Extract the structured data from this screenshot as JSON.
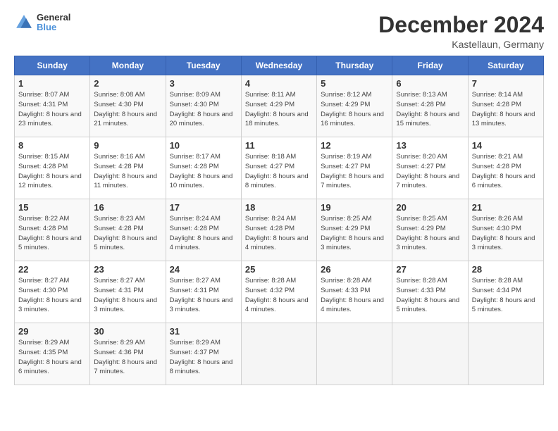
{
  "header": {
    "logo": {
      "line1": "General",
      "line2": "Blue"
    },
    "title": "December 2024",
    "subtitle": "Kastellaun, Germany"
  },
  "weekdays": [
    "Sunday",
    "Monday",
    "Tuesday",
    "Wednesday",
    "Thursday",
    "Friday",
    "Saturday"
  ],
  "weeks": [
    [
      {
        "day": "1",
        "sunrise": "Sunrise: 8:07 AM",
        "sunset": "Sunset: 4:31 PM",
        "daylight": "Daylight: 8 hours and 23 minutes."
      },
      {
        "day": "2",
        "sunrise": "Sunrise: 8:08 AM",
        "sunset": "Sunset: 4:30 PM",
        "daylight": "Daylight: 8 hours and 21 minutes."
      },
      {
        "day": "3",
        "sunrise": "Sunrise: 8:09 AM",
        "sunset": "Sunset: 4:30 PM",
        "daylight": "Daylight: 8 hours and 20 minutes."
      },
      {
        "day": "4",
        "sunrise": "Sunrise: 8:11 AM",
        "sunset": "Sunset: 4:29 PM",
        "daylight": "Daylight: 8 hours and 18 minutes."
      },
      {
        "day": "5",
        "sunrise": "Sunrise: 8:12 AM",
        "sunset": "Sunset: 4:29 PM",
        "daylight": "Daylight: 8 hours and 16 minutes."
      },
      {
        "day": "6",
        "sunrise": "Sunrise: 8:13 AM",
        "sunset": "Sunset: 4:28 PM",
        "daylight": "Daylight: 8 hours and 15 minutes."
      },
      {
        "day": "7",
        "sunrise": "Sunrise: 8:14 AM",
        "sunset": "Sunset: 4:28 PM",
        "daylight": "Daylight: 8 hours and 13 minutes."
      }
    ],
    [
      {
        "day": "8",
        "sunrise": "Sunrise: 8:15 AM",
        "sunset": "Sunset: 4:28 PM",
        "daylight": "Daylight: 8 hours and 12 minutes."
      },
      {
        "day": "9",
        "sunrise": "Sunrise: 8:16 AM",
        "sunset": "Sunset: 4:28 PM",
        "daylight": "Daylight: 8 hours and 11 minutes."
      },
      {
        "day": "10",
        "sunrise": "Sunrise: 8:17 AM",
        "sunset": "Sunset: 4:28 PM",
        "daylight": "Daylight: 8 hours and 10 minutes."
      },
      {
        "day": "11",
        "sunrise": "Sunrise: 8:18 AM",
        "sunset": "Sunset: 4:27 PM",
        "daylight": "Daylight: 8 hours and 8 minutes."
      },
      {
        "day": "12",
        "sunrise": "Sunrise: 8:19 AM",
        "sunset": "Sunset: 4:27 PM",
        "daylight": "Daylight: 8 hours and 7 minutes."
      },
      {
        "day": "13",
        "sunrise": "Sunrise: 8:20 AM",
        "sunset": "Sunset: 4:27 PM",
        "daylight": "Daylight: 8 hours and 7 minutes."
      },
      {
        "day": "14",
        "sunrise": "Sunrise: 8:21 AM",
        "sunset": "Sunset: 4:28 PM",
        "daylight": "Daylight: 8 hours and 6 minutes."
      }
    ],
    [
      {
        "day": "15",
        "sunrise": "Sunrise: 8:22 AM",
        "sunset": "Sunset: 4:28 PM",
        "daylight": "Daylight: 8 hours and 5 minutes."
      },
      {
        "day": "16",
        "sunrise": "Sunrise: 8:23 AM",
        "sunset": "Sunset: 4:28 PM",
        "daylight": "Daylight: 8 hours and 5 minutes."
      },
      {
        "day": "17",
        "sunrise": "Sunrise: 8:24 AM",
        "sunset": "Sunset: 4:28 PM",
        "daylight": "Daylight: 8 hours and 4 minutes."
      },
      {
        "day": "18",
        "sunrise": "Sunrise: 8:24 AM",
        "sunset": "Sunset: 4:28 PM",
        "daylight": "Daylight: 8 hours and 4 minutes."
      },
      {
        "day": "19",
        "sunrise": "Sunrise: 8:25 AM",
        "sunset": "Sunset: 4:29 PM",
        "daylight": "Daylight: 8 hours and 3 minutes."
      },
      {
        "day": "20",
        "sunrise": "Sunrise: 8:25 AM",
        "sunset": "Sunset: 4:29 PM",
        "daylight": "Daylight: 8 hours and 3 minutes."
      },
      {
        "day": "21",
        "sunrise": "Sunrise: 8:26 AM",
        "sunset": "Sunset: 4:30 PM",
        "daylight": "Daylight: 8 hours and 3 minutes."
      }
    ],
    [
      {
        "day": "22",
        "sunrise": "Sunrise: 8:27 AM",
        "sunset": "Sunset: 4:30 PM",
        "daylight": "Daylight: 8 hours and 3 minutes."
      },
      {
        "day": "23",
        "sunrise": "Sunrise: 8:27 AM",
        "sunset": "Sunset: 4:31 PM",
        "daylight": "Daylight: 8 hours and 3 minutes."
      },
      {
        "day": "24",
        "sunrise": "Sunrise: 8:27 AM",
        "sunset": "Sunset: 4:31 PM",
        "daylight": "Daylight: 8 hours and 3 minutes."
      },
      {
        "day": "25",
        "sunrise": "Sunrise: 8:28 AM",
        "sunset": "Sunset: 4:32 PM",
        "daylight": "Daylight: 8 hours and 4 minutes."
      },
      {
        "day": "26",
        "sunrise": "Sunrise: 8:28 AM",
        "sunset": "Sunset: 4:33 PM",
        "daylight": "Daylight: 8 hours and 4 minutes."
      },
      {
        "day": "27",
        "sunrise": "Sunrise: 8:28 AM",
        "sunset": "Sunset: 4:33 PM",
        "daylight": "Daylight: 8 hours and 5 minutes."
      },
      {
        "day": "28",
        "sunrise": "Sunrise: 8:28 AM",
        "sunset": "Sunset: 4:34 PM",
        "daylight": "Daylight: 8 hours and 5 minutes."
      }
    ],
    [
      {
        "day": "29",
        "sunrise": "Sunrise: 8:29 AM",
        "sunset": "Sunset: 4:35 PM",
        "daylight": "Daylight: 8 hours and 6 minutes."
      },
      {
        "day": "30",
        "sunrise": "Sunrise: 8:29 AM",
        "sunset": "Sunset: 4:36 PM",
        "daylight": "Daylight: 8 hours and 7 minutes."
      },
      {
        "day": "31",
        "sunrise": "Sunrise: 8:29 AM",
        "sunset": "Sunset: 4:37 PM",
        "daylight": "Daylight: 8 hours and 8 minutes."
      },
      null,
      null,
      null,
      null
    ]
  ]
}
